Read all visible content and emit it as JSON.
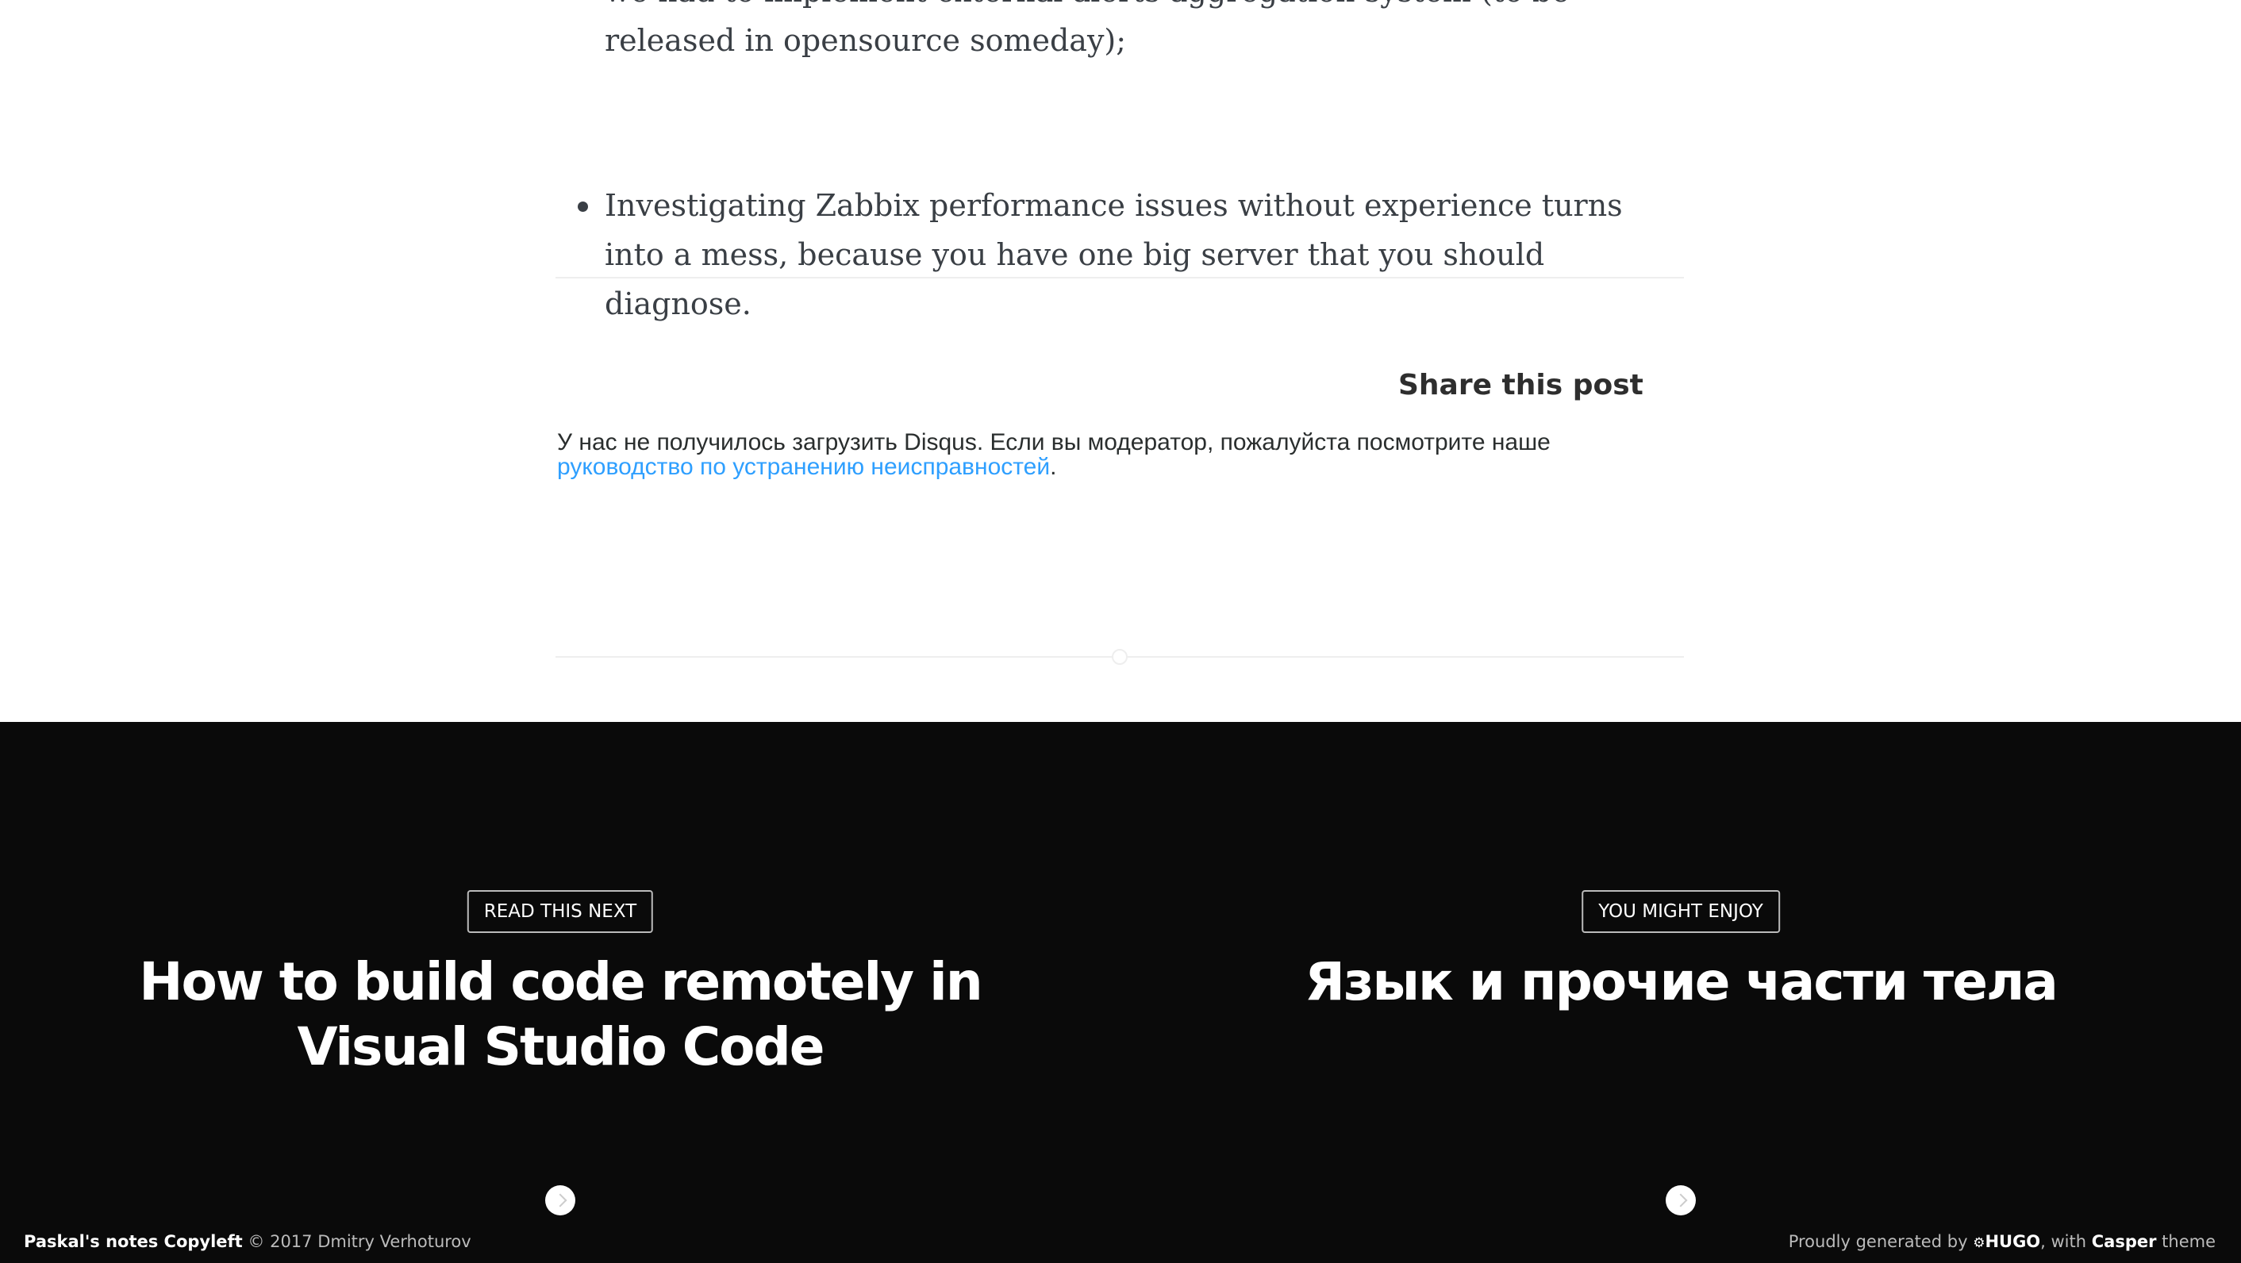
{
  "article": {
    "list_items": [
      "we had to implement external alerts aggregation system (to be released in opensource someday);",
      "Investigating Zabbix performance issues without experience turns into a mess, because you have one big server that you should diagnose."
    ],
    "share_title": "Share this post",
    "disqus": {
      "message": "У нас не получилось загрузить Disqus. Если вы модератор, пожалуйста посмотрите наше",
      "link_text": "руководство по устранению неисправностей",
      "end": "."
    }
  },
  "read_next": [
    {
      "label": "READ THIS NEXT",
      "title": "How to build code remotely in Visual Studio Code"
    },
    {
      "label": "YOU MIGHT ENJOY",
      "title": "Язык и прочие части тела"
    }
  ],
  "footer": {
    "site_name": "Paskal's notes Copyleft",
    "copyright": "© 2017 Dmitry Verhoturov",
    "generated_prefix": "Proudly generated by",
    "hugo_icon": "hugo-icon",
    "hugo": "HUGO",
    "with": ", with",
    "casper": "Casper",
    "theme": "theme"
  },
  "colors": {
    "text": "#3a3f45",
    "link": "#2e9fff",
    "footer_bg": "#0a0a0a"
  }
}
